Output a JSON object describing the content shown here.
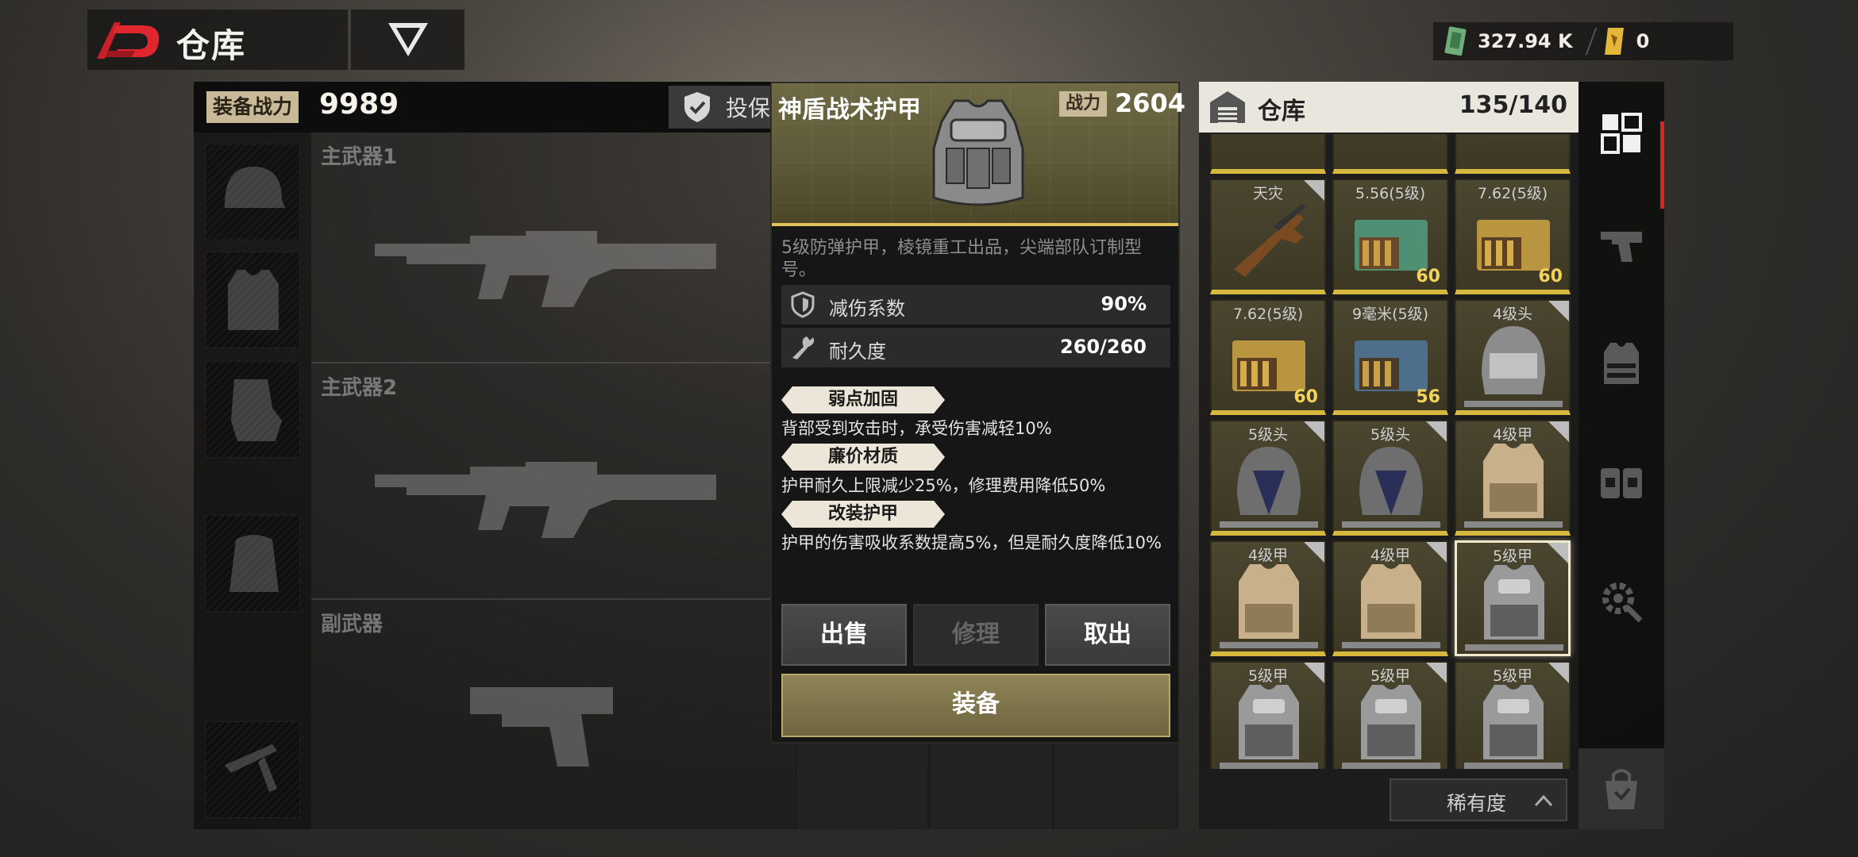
{
  "topbar": {
    "title": "仓库",
    "logo_icon": "game-logo-icon",
    "mode_icon": "chevron-v-icon"
  },
  "currency": {
    "cash": "327.94 K",
    "tickets": "0"
  },
  "loadout": {
    "power_label": "装备战力",
    "power_value": "9989",
    "insure_label": "投保",
    "slots": [
      {
        "name": "helmet-slot",
        "icon": "helmet-icon"
      },
      {
        "name": "armor-slot",
        "icon": "vest-icon"
      },
      {
        "name": "backpack-small-slot",
        "icon": "pouch-icon"
      },
      {
        "name": "backpack-slot",
        "icon": "backpack-icon"
      },
      {
        "name": "melee-slot",
        "icon": "tool-icon"
      }
    ],
    "weapons": [
      {
        "label": "主武器1"
      },
      {
        "label": "主武器2"
      },
      {
        "label": "副武器"
      }
    ]
  },
  "detail": {
    "name": "神盾战术护甲",
    "cp_tag": "战力",
    "cp_value": "2604",
    "description": "5级防弹护甲，棱镜重工出品，尖端部队订制型号。",
    "stats": [
      {
        "name": "减伤系数",
        "value": "90%",
        "icon": "shield-icon"
      },
      {
        "name": "耐久度",
        "value": "260/260",
        "icon": "wrench-icon"
      }
    ],
    "traits": [
      {
        "tag": "弱点加固",
        "desc": "背部受到攻击时，承受伤害减轻10%"
      },
      {
        "tag": "廉价材质",
        "desc": "护甲耐久上限减少25%，修理费用降低50%"
      },
      {
        "tag": "改装护甲",
        "desc": "护甲的伤害吸收系数提高5%，但是耐久度降低10%"
      }
    ],
    "buttons": {
      "sell": "出售",
      "repair": "修理",
      "take": "取出",
      "equip": "装备"
    }
  },
  "warehouse": {
    "title": "仓库",
    "count": "135/140",
    "sort_label": "稀有度",
    "cells": [
      {
        "name": "",
        "qty": "",
        "kind": "partial"
      },
      {
        "name": "",
        "qty": "",
        "kind": "partial"
      },
      {
        "name": "",
        "qty": "",
        "kind": "partial"
      },
      {
        "name": "天灾",
        "qty": "",
        "kind": "rifle"
      },
      {
        "name": "5.56(5级)",
        "qty": "60",
        "kind": "ammo-green"
      },
      {
        "name": "7.62(5级)",
        "qty": "60",
        "kind": "ammo-gold"
      },
      {
        "name": "7.62(5级)",
        "qty": "60",
        "kind": "ammo-gold"
      },
      {
        "name": "9毫米(5级)",
        "qty": "56",
        "kind": "ammo-blue"
      },
      {
        "name": "4级头",
        "qty": "",
        "kind": "helmet"
      },
      {
        "name": "5级头",
        "qty": "",
        "kind": "helmet-dark"
      },
      {
        "name": "5级头",
        "qty": "",
        "kind": "helmet-dark"
      },
      {
        "name": "4级甲",
        "qty": "",
        "kind": "vest-tan"
      },
      {
        "name": "4级甲",
        "qty": "",
        "kind": "vest-tan"
      },
      {
        "name": "4级甲",
        "qty": "",
        "kind": "vest-tan"
      },
      {
        "name": "5级甲",
        "qty": "",
        "kind": "vest-grey"
      },
      {
        "name": "5级甲",
        "qty": "",
        "kind": "vest-grey"
      },
      {
        "name": "5级甲",
        "qty": "",
        "kind": "vest-grey"
      },
      {
        "name": "5级甲",
        "qty": "",
        "kind": "vest-grey"
      }
    ]
  },
  "rail": [
    {
      "name": "rail-all",
      "icon": "grid-icon"
    },
    {
      "name": "rail-weapons",
      "icon": "pistol-icon"
    },
    {
      "name": "rail-armor",
      "icon": "vest-icon"
    },
    {
      "name": "rail-ammo",
      "icon": "ammo-box-icon"
    },
    {
      "name": "rail-parts",
      "icon": "gear-wrench-icon"
    }
  ],
  "rail_shop_icon": "shopping-bag-icon"
}
